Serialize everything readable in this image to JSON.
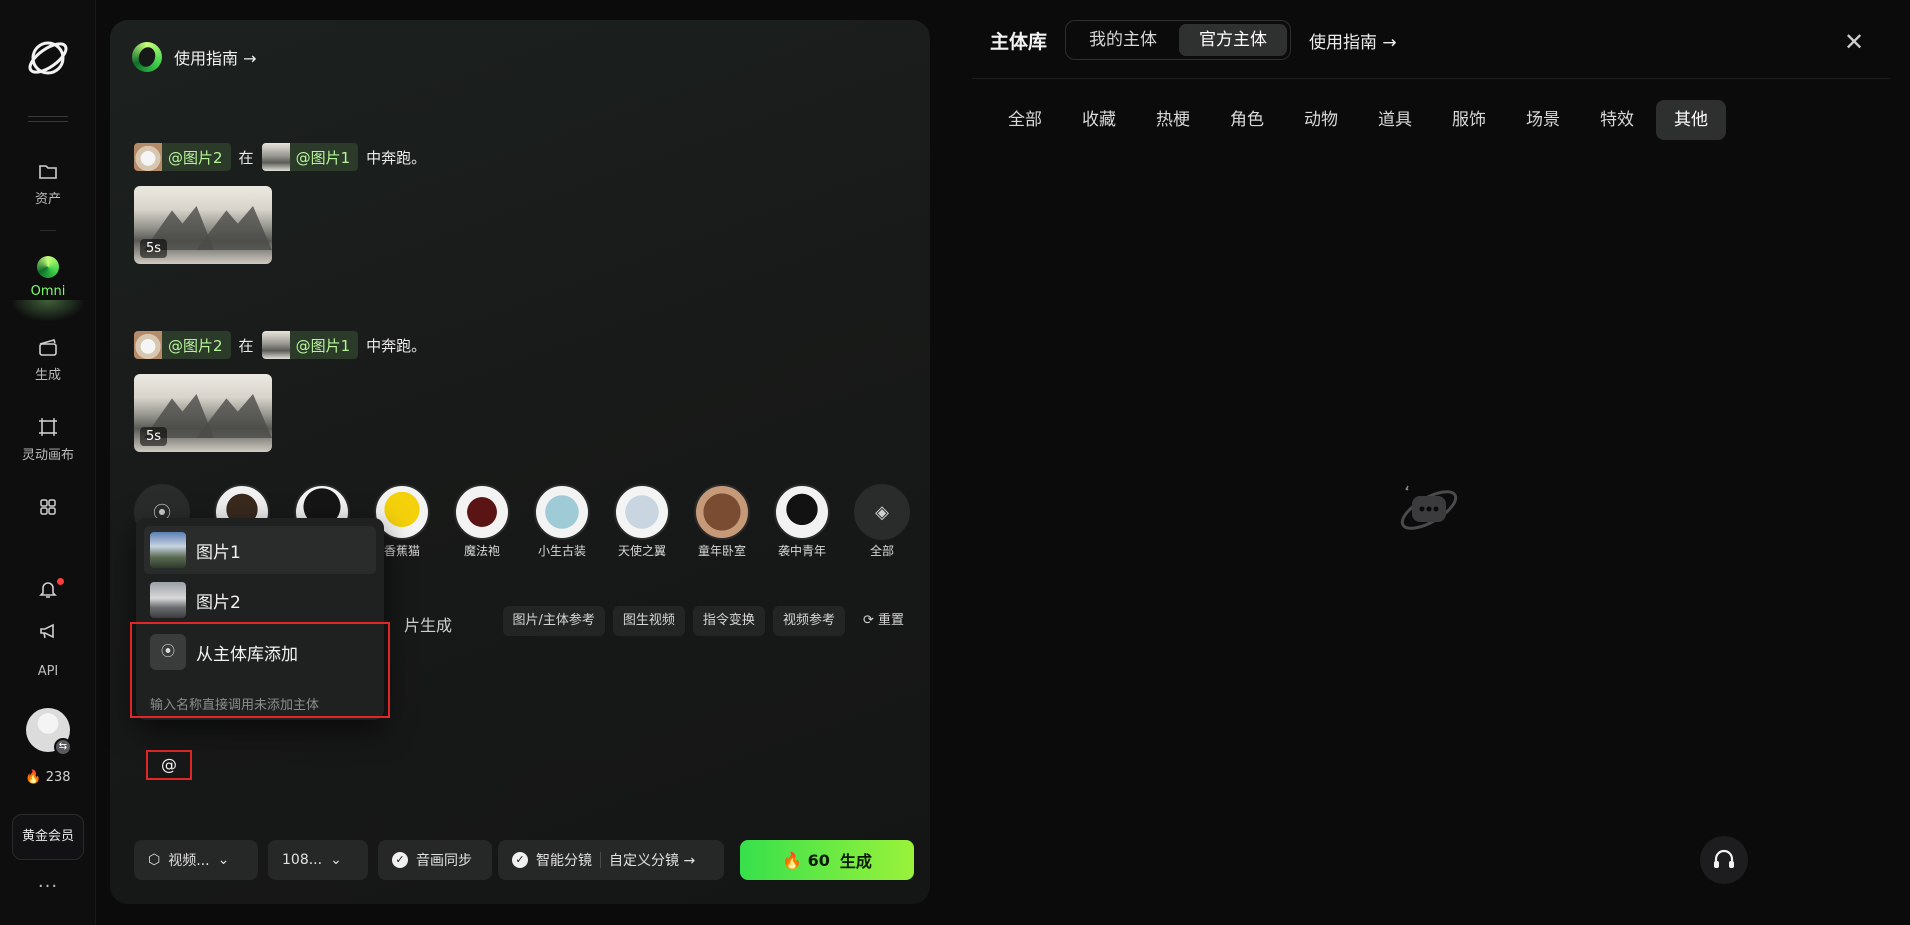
{
  "rail": {
    "items": [
      {
        "label": "资产",
        "icon": "folder-icon"
      },
      {
        "label": "Omni",
        "icon": "omni-icon",
        "active": true
      },
      {
        "label": "生成",
        "icon": "clapper-icon"
      },
      {
        "label": "灵动画布",
        "icon": "canvas-icon"
      },
      {
        "label": "",
        "icon": "apps-grid-icon"
      }
    ],
    "api_label": "API",
    "credits": "238",
    "vip_label": "黄金会员",
    "more_label": "···"
  },
  "main": {
    "guide_label": "使用指南 →",
    "prompts": [
      {
        "tag1": "@图片2",
        "mid": "在",
        "tag2": "@图片1",
        "tail": "中奔跑。",
        "duration": "5s"
      },
      {
        "tag1": "@图片2",
        "mid": "在",
        "tag2": "@图片1",
        "tail": "中奔跑。",
        "duration": "5s"
      }
    ],
    "subjects": [
      {
        "label": ""
      },
      {
        "label": ""
      },
      {
        "label": "香蕉猫"
      },
      {
        "label": "魔法袍"
      },
      {
        "label": "小生古装"
      },
      {
        "label": "天使之翼"
      },
      {
        "label": "童年卧室"
      },
      {
        "label": "袭中青年"
      },
      {
        "label": "全部"
      }
    ],
    "mode_tab": "片生成",
    "chips": [
      "图片/主体参考",
      "图生视频",
      "指令变换",
      "视频参考",
      "重置"
    ],
    "at_symbol": "@",
    "dropdown": {
      "items": [
        "图片1",
        "图片2",
        "从主体库添加"
      ],
      "hint": "输入名称直接调用未添加主体"
    },
    "toolbar": {
      "type_label": "视频...",
      "resolution_label": "108...",
      "audio_sync": "音画同步",
      "smart_shot": "智能分镜",
      "custom_shot": "自定义分镜 →",
      "cost": "60",
      "generate_label": "生成"
    }
  },
  "right": {
    "title": "主体库",
    "segments": [
      "我的主体",
      "官方主体"
    ],
    "active_segment": 1,
    "guide_label": "使用指南 →",
    "categories": [
      "全部",
      "收藏",
      "热梗",
      "角色",
      "动物",
      "道具",
      "服饰",
      "场景",
      "特效",
      "其他"
    ],
    "active_category": 9
  },
  "colors": {
    "accent_green": "#7bff6a",
    "generate_gradient_start": "#36e04c",
    "generate_gradient_end": "#9af23a",
    "highlight_red": "#e02727"
  }
}
